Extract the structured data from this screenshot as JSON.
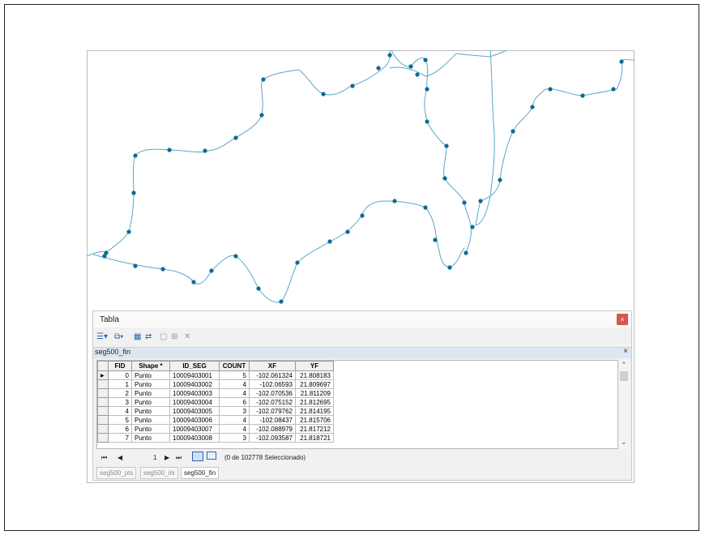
{
  "colors": {
    "line": "#5aa7c9",
    "point": "#0b6a93",
    "close": "#d9534f"
  },
  "window": {
    "title": "Tabla",
    "close_icon": "×"
  },
  "toolbar": {
    "icons": [
      "table-options-icon",
      "related-tables-icon",
      "select-by-attributes-icon",
      "switch-selection-icon",
      "clear-selection-icon",
      "zoom-to-selected-icon",
      "delete-selected-icon"
    ]
  },
  "table": {
    "name": "seg500_fin",
    "close_icon": "×",
    "columns": [
      "FID",
      "Shape *",
      "ID_SEG",
      "COUNT",
      "XF",
      "YF"
    ],
    "rows": [
      [
        "0",
        "Punto",
        "10009403001",
        "5",
        "-102.061324",
        "21.808183"
      ],
      [
        "1",
        "Punto",
        "10009403002",
        "4",
        "-102.06593",
        "21.809697"
      ],
      [
        "2",
        "Punto",
        "10009403003",
        "4",
        "-102.070536",
        "21.811209"
      ],
      [
        "3",
        "Punto",
        "10009403004",
        "6",
        "-102.075152",
        "21.812695"
      ],
      [
        "4",
        "Punto",
        "10009403005",
        "3",
        "-102.079762",
        "21.814195"
      ],
      [
        "5",
        "Punto",
        "10009403006",
        "4",
        "-102.08437",
        "21.815706"
      ],
      [
        "6",
        "Punto",
        "10009403007",
        "4",
        "-102.088979",
        "21.817212"
      ],
      [
        "7",
        "Punto",
        "10009403008",
        "3",
        "-102.093587",
        "21.818721"
      ]
    ]
  },
  "nav": {
    "first": "⏮",
    "prev": "◀",
    "current": "1",
    "next": "▶",
    "last": "⏭",
    "status": "(0 de 102778 Seleccionado)"
  },
  "tabs": [
    "seg500_pts",
    "seg500_ini",
    "seg500_fin"
  ]
}
